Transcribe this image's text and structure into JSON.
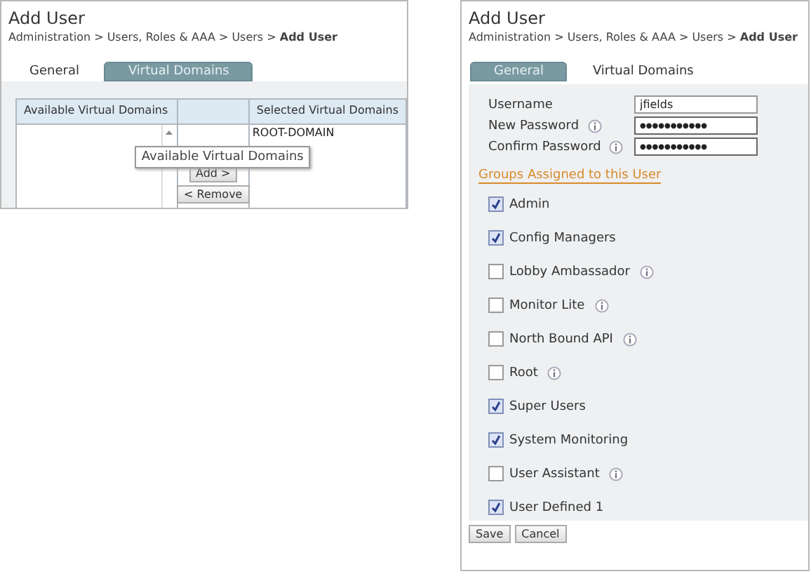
{
  "left_panel": {
    "title": "Add User",
    "breadcrumb": "Administration > Users, Roles & AAA > Users > **Add User**",
    "tabs": [
      {
        "label": "General",
        "selected": false
      },
      {
        "label": "Virtual Domains",
        "selected": true
      }
    ],
    "columns": [
      "Available Virtual Domains",
      "Selected Virtual Domains"
    ],
    "selected_domains": [
      "ROOT-DOMAIN"
    ],
    "buttons": [
      "Add >",
      "< Remove"
    ],
    "tooltip": "Available Virtual Domains"
  },
  "right_panel": {
    "title": "Add User",
    "breadcrumb": "Administration > Users, Roles & AAA > Users > **Add User**",
    "tabs": [
      {
        "label": "General",
        "selected": true
      },
      {
        "label": "Virtual Domains",
        "selected": false
      }
    ],
    "fields": [
      {
        "label": "Username",
        "value": "jfields",
        "kind": "text",
        "info": false
      },
      {
        "label": "New Password",
        "value": "●●●●●●●●●●●",
        "kind": "password",
        "info": true
      },
      {
        "label": "Confirm Password",
        "value": "●●●●●●●●●●●",
        "kind": "password",
        "info": true
      }
    ],
    "groups_link": "Groups Assigned to this User",
    "groups": [
      {
        "label": "Admin",
        "checked": true,
        "info": false
      },
      {
        "label": "Config Managers",
        "checked": true,
        "info": false
      },
      {
        "label": "Lobby Ambassador",
        "checked": false,
        "info": true
      },
      {
        "label": "Monitor Lite",
        "checked": false,
        "info": true
      },
      {
        "label": "North Bound API",
        "checked": false,
        "info": true
      },
      {
        "label": "Root",
        "checked": false,
        "info": true
      },
      {
        "label": "Super Users",
        "checked": true,
        "info": false
      },
      {
        "label": "System Monitoring",
        "checked": true,
        "info": false
      },
      {
        "label": "User Assistant",
        "checked": false,
        "info": true
      },
      {
        "label": "User Defined 1",
        "checked": true,
        "info": false
      }
    ],
    "buttons": [
      "Save",
      "Cancel"
    ]
  }
}
